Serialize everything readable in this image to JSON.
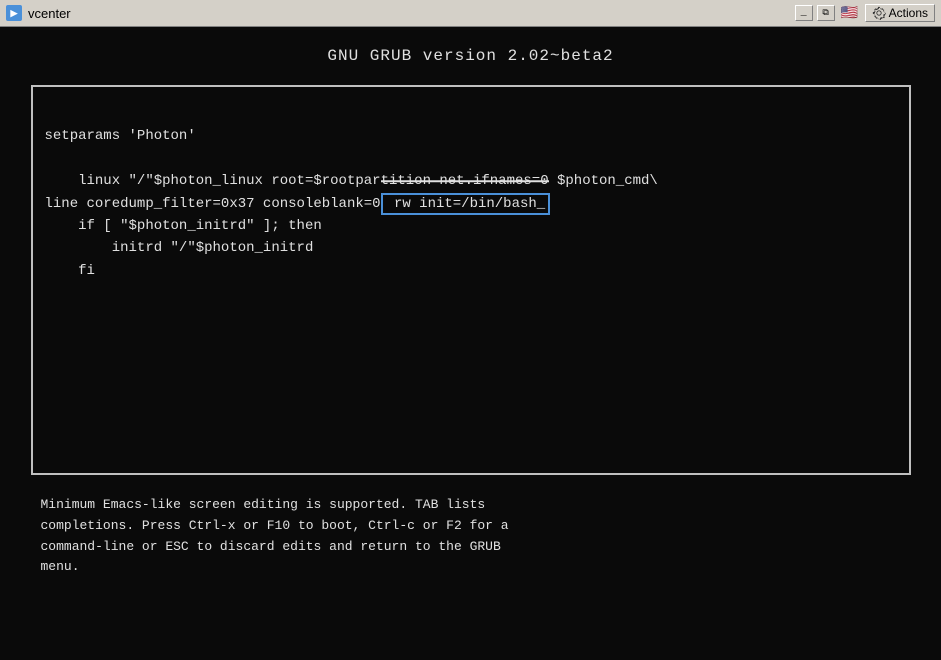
{
  "titlebar": {
    "title": "vcenter",
    "icon": "v",
    "minimize_label": "_",
    "maximize_label": "□",
    "restore_label": "⧉",
    "actions_label": "Actions",
    "flag_emoji": "🇺🇸"
  },
  "grub": {
    "header": "GNU GRUB  version 2.02~beta2",
    "code_line1": "setparams 'Photon'",
    "code_line2": "    linux \"/\"$photon_linux root=$rootpar",
    "code_line2_struck": "tition net.ifnames=0",
    "code_line2_end": " $photon_cmd\\",
    "code_line3_start": "line coredump_filter=0x37 consoleblank=0",
    "code_line3_highlight": "rw init=/bin/bash_",
    "code_line4": "    if [ \"$photon_initrd\" ]; then",
    "code_line5": "        initrd \"/\"$photon_initrd",
    "code_line6": "    fi"
  },
  "footer": {
    "line1": "    Minimum Emacs-like screen editing is supported. TAB lists",
    "line2": "    completions. Press Ctrl-x or F10 to boot, Ctrl-c or F2 for a",
    "line3": "    command-line or ESC to discard edits and return to the GRUB",
    "line4": "    menu."
  }
}
